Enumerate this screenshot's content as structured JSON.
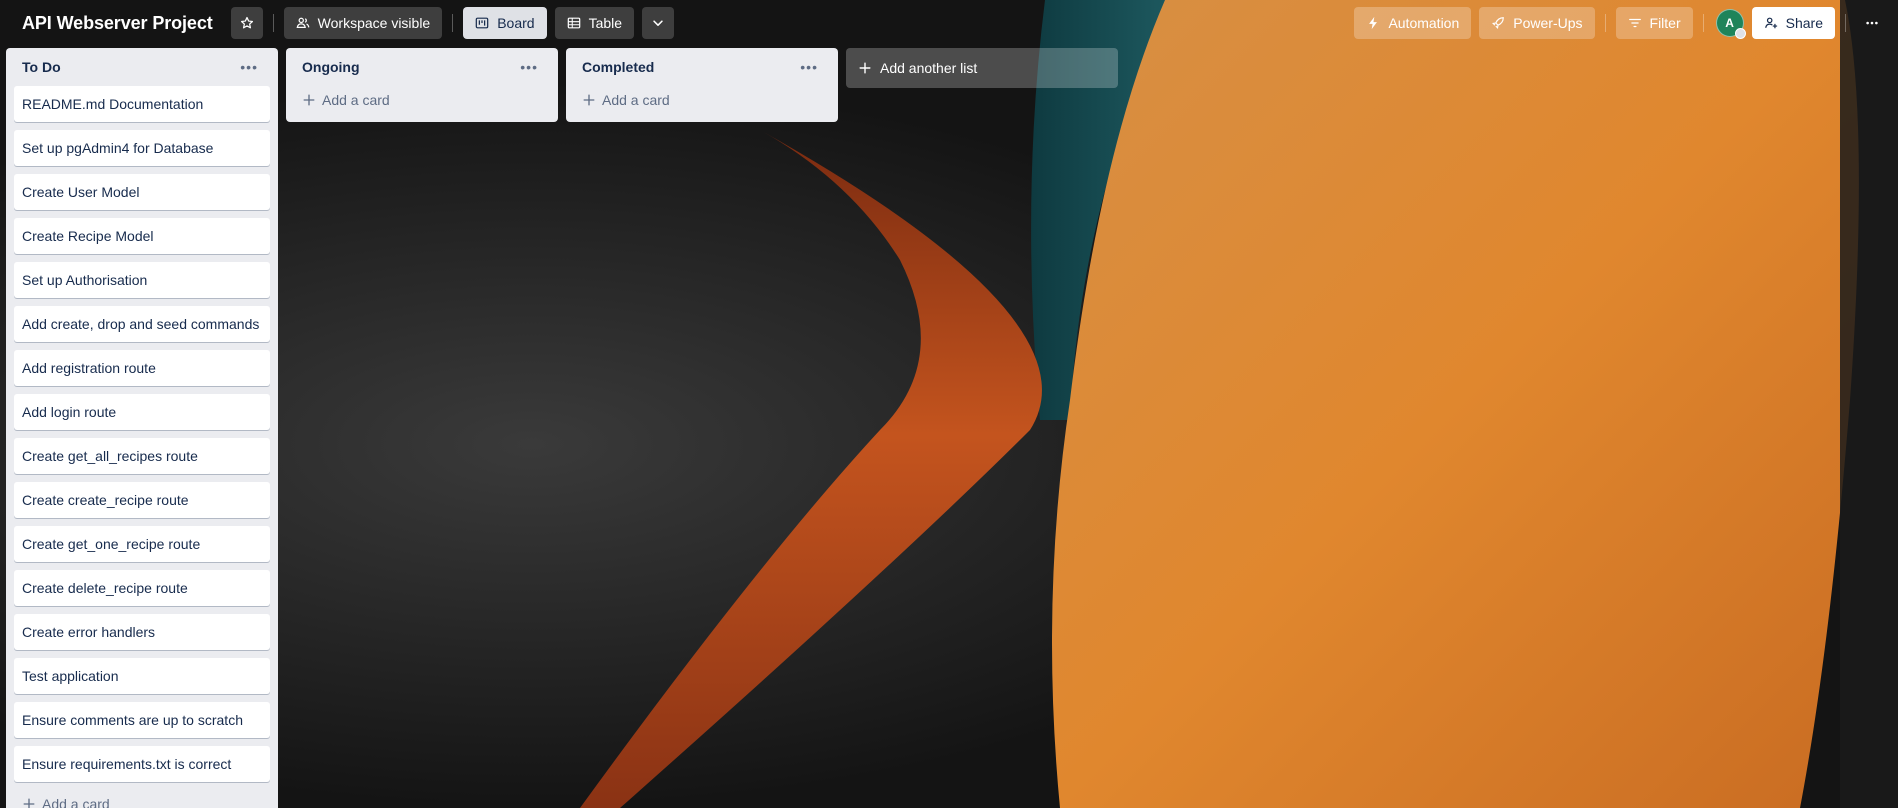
{
  "header": {
    "board_title": "API Webserver Project",
    "visibility_label": "Workspace visible",
    "views": [
      {
        "label": "Board",
        "icon": "board-icon",
        "active": true
      },
      {
        "label": "Table",
        "icon": "table-icon",
        "active": false
      }
    ],
    "automation_label": "Automation",
    "powerups_label": "Power-Ups",
    "filter_label": "Filter",
    "avatar_initial": "A",
    "share_label": "Share"
  },
  "lists": [
    {
      "title": "To Do",
      "cards": [
        "README.md Documentation",
        "Set up pgAdmin4 for Database",
        "Create User Model",
        "Create Recipe Model",
        "Set up Authorisation",
        "Add create, drop and seed commands",
        "Add registration route",
        "Add login route",
        "Create get_all_recipes route",
        "Create create_recipe route",
        "Create get_one_recipe route",
        "Create delete_recipe route",
        "Create error handlers",
        "Test application",
        "Ensure comments are up to scratch",
        "Ensure requirements.txt is correct"
      ],
      "add_card_label": "Add a card"
    },
    {
      "title": "Ongoing",
      "cards": [],
      "add_card_label": "Add a card"
    },
    {
      "title": "Completed",
      "cards": [],
      "add_card_label": "Add a card"
    }
  ],
  "add_list_label": "Add another list",
  "colors": {
    "list_bg": "#ebecf0",
    "avatar": "#1f845a",
    "background_dark": "#161616",
    "accent_orange": "#d8893a",
    "accent_red": "#b5441c",
    "accent_teal": "#1b4f56"
  }
}
